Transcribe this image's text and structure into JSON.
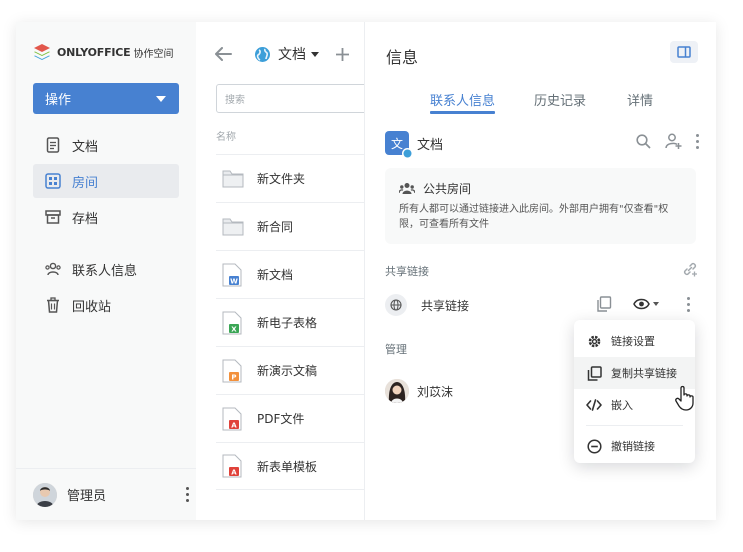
{
  "sidebar": {
    "brand_name": "ONLYOFFICE",
    "brand_sub": "协作空间",
    "action_label": "操作",
    "items": [
      {
        "label": "文档",
        "icon": "document-icon",
        "active": false
      },
      {
        "label": "房间",
        "icon": "rooms-icon",
        "active": true
      },
      {
        "label": "存档",
        "icon": "archive-icon",
        "active": false
      },
      {
        "label": "联系人信息",
        "icon": "contacts-icon",
        "active": false
      },
      {
        "label": "回收站",
        "icon": "trash-icon",
        "active": false
      }
    ],
    "user_name": "管理员"
  },
  "files": {
    "breadcrumb": "文档",
    "search_placeholder": "搜索",
    "column_name": "名称",
    "rows": [
      {
        "name": "新文件夹",
        "type": "folder"
      },
      {
        "name": "新合同",
        "type": "folder"
      },
      {
        "name": "新文档",
        "type": "docx",
        "badge": "W",
        "color": "#4781d1"
      },
      {
        "name": "新电子表格",
        "type": "xlsx",
        "badge": "X",
        "color": "#3aa655"
      },
      {
        "name": "新演示文稿",
        "type": "pptx",
        "badge": "P",
        "color": "#f3913c"
      },
      {
        "name": "PDF文件",
        "type": "pdf",
        "badge": "A",
        "color": "#e0423a"
      },
      {
        "name": "新表单模板",
        "type": "form",
        "badge": "A",
        "color": "#e0423a"
      }
    ]
  },
  "panel": {
    "title": "信息",
    "tabs": [
      "联系人信息",
      "历史记录",
      "详情"
    ],
    "room_icon_letter": "文",
    "room_name": "文档",
    "notice_title": "公共房间",
    "notice_text": "所有人都可以通过链接进入此房间。外部用户拥有\"仅查看\"权限，可查看所有文件",
    "share_section": "共享链接",
    "share_link_label": "共享链接",
    "manage_section": "管理",
    "member_name": "刘苡沫"
  },
  "dropdown": {
    "items": [
      "链接设置",
      "复制共享链接",
      "嵌入",
      "撤销链接"
    ]
  },
  "colors": {
    "accent": "#4781d1",
    "sidebar_bg": "#f8f9f9"
  }
}
